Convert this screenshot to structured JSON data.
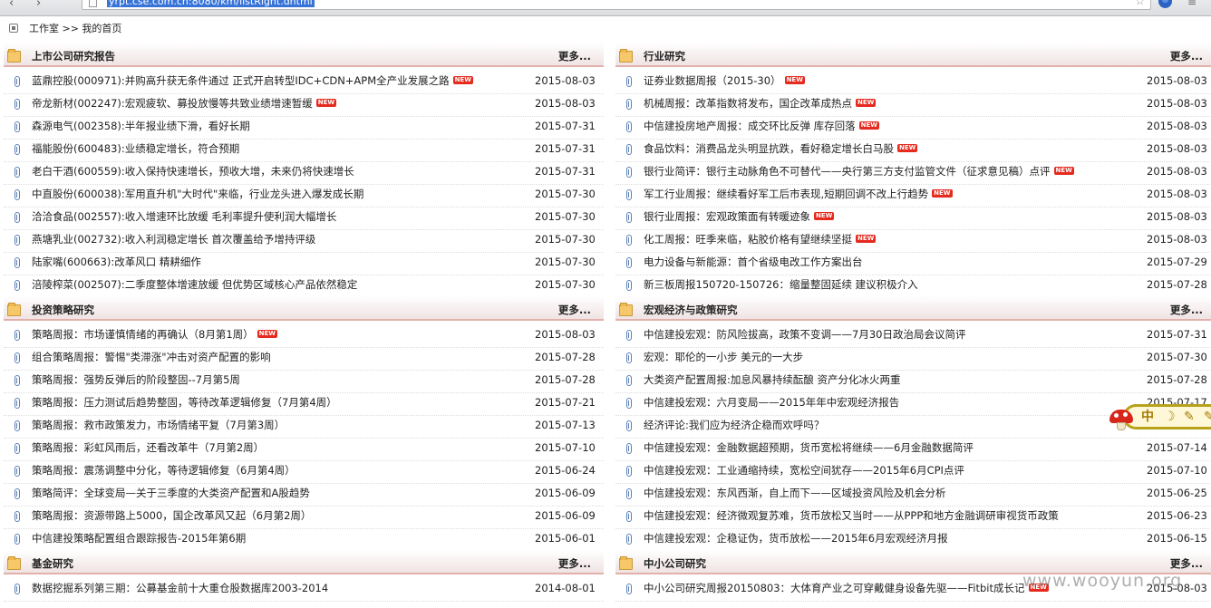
{
  "browser": {
    "url": "yrpt.cse.com.cn:8080/km/listRight.dhtml",
    "back_icon": "chevron-left-icon",
    "forward_icon": "chevron-right-icon"
  },
  "breadcrumb": {
    "text": "工作室 >> 我的首页"
  },
  "more_label": "更多...",
  "new_badge": "NEW",
  "panels": [
    {
      "title": "上市公司研究报告",
      "rows": [
        {
          "title": "蓝鼎控股(000971):并购高升获无条件通过 正式开启转型IDC+CDN+APM全产业发展之路",
          "date": "2015-08-03",
          "new": true
        },
        {
          "title": "帝龙新材(002247):宏观疲软、募投放慢等共致业绩增速暂缓",
          "date": "2015-08-03",
          "new": true
        },
        {
          "title": "森源电气(002358):半年报业绩下滑，看好长期",
          "date": "2015-07-31",
          "new": false
        },
        {
          "title": "福能股份(600483):业绩稳定增长，符合预期",
          "date": "2015-07-31",
          "new": false
        },
        {
          "title": "老白干酒(600559):收入保持快速增长，预收大增，未来仍将快速增长",
          "date": "2015-07-31",
          "new": false
        },
        {
          "title": "中直股份(600038):军用直升机\"大时代\"来临，行业龙头进入爆发成长期",
          "date": "2015-07-30",
          "new": false
        },
        {
          "title": "洽洽食品(002557):收入增速环比放缓 毛利率提升使利润大幅增长",
          "date": "2015-07-30",
          "new": false
        },
        {
          "title": "燕塘乳业(002732):收入利润稳定增长 首次覆盖给予增持评级",
          "date": "2015-07-30",
          "new": false
        },
        {
          "title": "陆家嘴(600663):改革风口 精耕细作",
          "date": "2015-07-30",
          "new": false
        },
        {
          "title": "涪陵榨菜(002507):二季度整体增速放缓 但优势区域核心产品依然稳定",
          "date": "2015-07-30",
          "new": false
        }
      ]
    },
    {
      "title": "行业研究",
      "rows": [
        {
          "title": "证券业数据周报（2015-30）",
          "date": "2015-08-03",
          "new": true
        },
        {
          "title": "机械周报：改革指数将发布，国企改革成热点",
          "date": "2015-08-03",
          "new": true
        },
        {
          "title": "中信建投房地产周报：成交环比反弹 库存回落",
          "date": "2015-08-03",
          "new": true
        },
        {
          "title": "食品饮料：消费品龙头明显抗跌，看好稳定增长白马股",
          "date": "2015-08-03",
          "new": true
        },
        {
          "title": "银行业简评：银行主动脉角色不可替代——央行第三方支付监管文件（征求意见稿）点评",
          "date": "2015-08-03",
          "new": true
        },
        {
          "title": "军工行业周报：继续看好军工后市表现,短期回调不改上行趋势",
          "date": "2015-08-03",
          "new": true
        },
        {
          "title": "银行业周报：宏观政策面有转暖迹象",
          "date": "2015-08-03",
          "new": true
        },
        {
          "title": "化工周报：旺季来临，粘胶价格有望继续坚挺",
          "date": "2015-08-03",
          "new": true
        },
        {
          "title": "电力设备与新能源：首个省级电改工作方案出台",
          "date": "2015-07-29",
          "new": false
        },
        {
          "title": "新三板周报150720-150726：缩量整固延续  建议积极介入",
          "date": "2015-07-28",
          "new": false
        }
      ]
    },
    {
      "title": "投资策略研究",
      "rows": [
        {
          "title": "策略周报：市场谨慎情绪的再确认（8月第1周）",
          "date": "2015-08-03",
          "new": true
        },
        {
          "title": "组合策略周报：警惕\"类滞涨\"冲击对资产配置的影响",
          "date": "2015-07-28",
          "new": false
        },
        {
          "title": "策略周报：强势反弹后的阶段整固--7月第5周",
          "date": "2015-07-28",
          "new": false
        },
        {
          "title": "策略周报：压力测试后趋势整固，等待改革逻辑修复（7月第4周）",
          "date": "2015-07-21",
          "new": false
        },
        {
          "title": "策略周报：救市政策发力，市场情绪平复（7月第3周）",
          "date": "2015-07-13",
          "new": false
        },
        {
          "title": "策略周报：彩虹风雨后，还看改革牛（7月第2周）",
          "date": "2015-07-10",
          "new": false
        },
        {
          "title": "策略周报：震荡调整中分化，等待逻辑修复（6月第4周）",
          "date": "2015-06-24",
          "new": false
        },
        {
          "title": "策略简评：全球变局—关于三季度的大类资产配置和A股趋势",
          "date": "2015-06-09",
          "new": false
        },
        {
          "title": "策略周报：资源带路上5000，国企改革风又起（6月第2周）",
          "date": "2015-06-09",
          "new": false
        },
        {
          "title": "中信建投策略配置组合跟踪报告-2015年第6期",
          "date": "2015-06-01",
          "new": false
        }
      ]
    },
    {
      "title": "宏观经济与政策研究",
      "rows": [
        {
          "title": "中信建投宏观：防风险拔高，政策不变调——7月30日政治局会议简评",
          "date": "2015-07-31",
          "new": false
        },
        {
          "title": "宏观：耶伦的一小步 美元的一大步",
          "date": "2015-07-30",
          "new": false
        },
        {
          "title": "大类资产配置周报:加息风暴持续酝酿 资产分化冰火两重",
          "date": "2015-07-28",
          "new": false
        },
        {
          "title": "中信建投宏观：六月变局——2015年年中宏观经济报告",
          "date": "2015-07-17",
          "new": false
        },
        {
          "title": "经济评论:我们应为经济企稳而欢呼吗？",
          "date": "",
          "new": false
        },
        {
          "title": "中信建投宏观：金融数据超预期，货币宽松将继续——6月金融数据简评",
          "date": "2015-07-14",
          "new": false
        },
        {
          "title": "中信建投宏观：工业通缩持续，宽松空间犹存——2015年6月CPI点评",
          "date": "2015-07-10",
          "new": false
        },
        {
          "title": "中信建投宏观：东风西渐，自上而下——区域投资风险及机会分析",
          "date": "2015-06-25",
          "new": false
        },
        {
          "title": "中信建投宏观：经济微观复苏难，货币放松又当时——从PPP和地方金融调研审视货币政策",
          "date": "2015-06-23",
          "new": false
        },
        {
          "title": "中信建投宏观：企稳证伪，货币放松——2015年6月宏观经济月报",
          "date": "2015-06-15",
          "new": false
        }
      ]
    },
    {
      "title": "基金研究",
      "rows": [
        {
          "title": "数据挖掘系列第三期：公募基金前十大重仓股数据库2003-2014",
          "date": "2014-08-01",
          "new": false
        }
      ]
    },
    {
      "title": "中小公司研究",
      "rows": [
        {
          "title": "中小公司研究周报20150803：大体育产业之可穿戴健身设备先驱——Fitbit成长记",
          "date": "2015-08-03",
          "new": true
        }
      ]
    }
  ],
  "float_toolbar": {
    "glyph1": "中",
    "glyph2": "☽",
    "glyph3": "✎",
    "glyph4": "✎",
    "icon": "mushroom-icon"
  },
  "watermark": "www.wooyun.org"
}
